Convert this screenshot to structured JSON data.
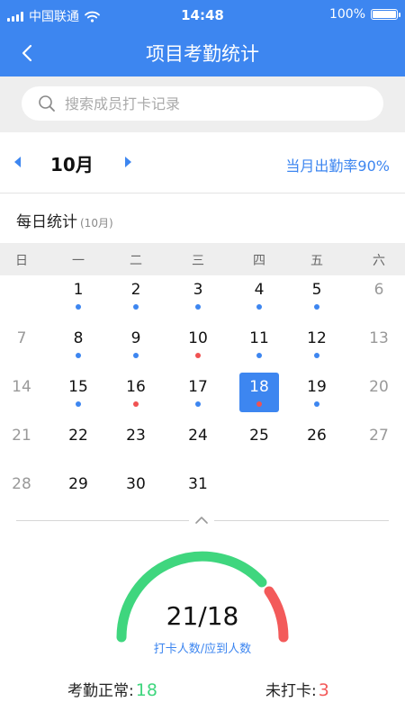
{
  "status_bar": {
    "carrier": "中国联通",
    "time": "14:48",
    "battery": "100%"
  },
  "nav": {
    "title": "项目考勤统计"
  },
  "search": {
    "placeholder": "搜索成员打卡记录"
  },
  "month": {
    "label": "10月",
    "attendance_rate": "当月出勤率90%"
  },
  "daily": {
    "title": "每日统计",
    "subtitle": "(10月)"
  },
  "weekdays": [
    "日",
    "一",
    "二",
    "三",
    "四",
    "五",
    "六"
  ],
  "colors": {
    "primary": "#3d86f0",
    "normal": "#3d86f0",
    "absent": "#f05252",
    "green": "#3fd67e",
    "red": "#f35a5a"
  },
  "calendar": {
    "selected_day": "18",
    "weeks": [
      [
        null,
        {
          "day": "1",
          "status": "normal"
        },
        {
          "day": "2",
          "status": "normal"
        },
        {
          "day": "3",
          "status": "normal"
        },
        {
          "day": "4",
          "status": "normal"
        },
        {
          "day": "5",
          "status": "normal"
        },
        {
          "day": "6",
          "status": null
        }
      ],
      [
        {
          "day": "7",
          "status": null
        },
        {
          "day": "8",
          "status": "normal"
        },
        {
          "day": "9",
          "status": "normal"
        },
        {
          "day": "10",
          "status": "absent"
        },
        {
          "day": "11",
          "status": "normal"
        },
        {
          "day": "12",
          "status": "normal"
        },
        {
          "day": "13",
          "status": null
        }
      ],
      [
        {
          "day": "14",
          "status": null
        },
        {
          "day": "15",
          "status": "normal"
        },
        {
          "day": "16",
          "status": "absent"
        },
        {
          "day": "17",
          "status": "normal"
        },
        {
          "day": "18",
          "status": "absent"
        },
        {
          "day": "19",
          "status": "normal"
        },
        {
          "day": "20",
          "status": null
        }
      ],
      [
        {
          "day": "21",
          "status": null
        },
        {
          "day": "22",
          "status": null
        },
        {
          "day": "23",
          "status": null
        },
        {
          "day": "24",
          "status": null
        },
        {
          "day": "25",
          "status": null
        },
        {
          "day": "26",
          "status": null
        },
        {
          "day": "27",
          "status": null
        }
      ],
      [
        {
          "day": "28",
          "status": null
        },
        {
          "day": "29",
          "status": null
        },
        {
          "day": "30",
          "status": null
        },
        {
          "day": "31",
          "status": null
        },
        null,
        null,
        null
      ]
    ]
  },
  "summary": {
    "ratio": "21/18",
    "ratio_label": "打卡人数/应到人数",
    "normal_label": "考勤正常:",
    "normal_value": "18",
    "missed_label": "未打卡:",
    "missed_value": "3"
  }
}
